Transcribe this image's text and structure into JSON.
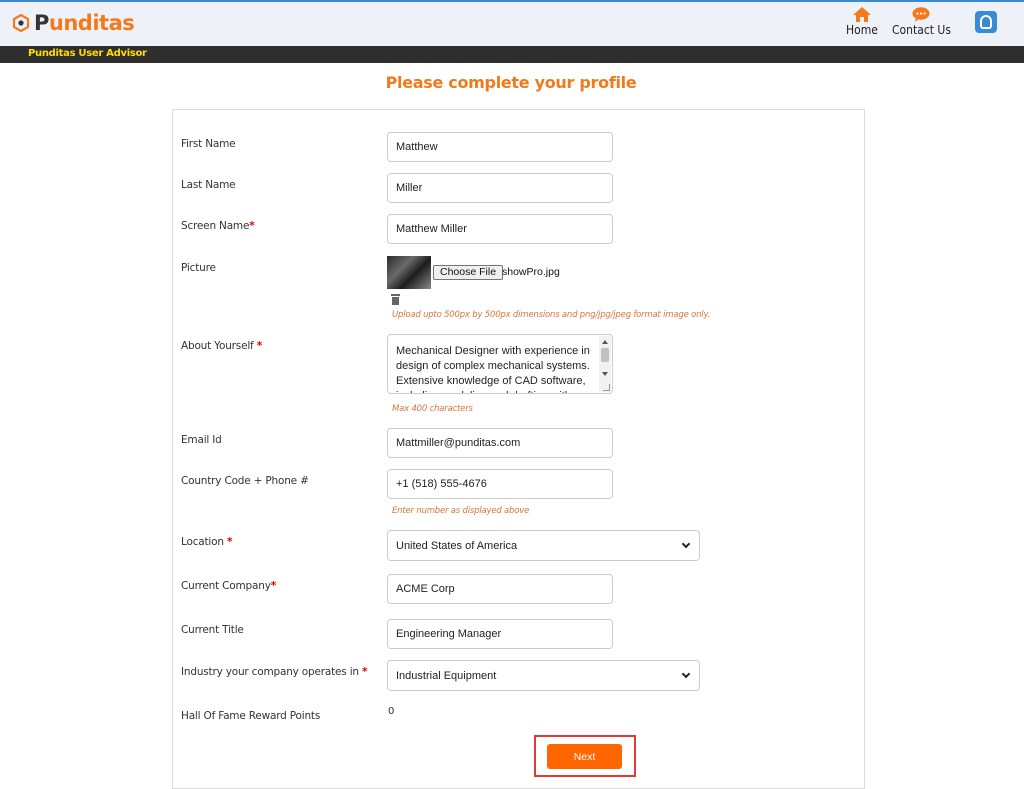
{
  "header": {
    "logo_prefix": "P",
    "logo_rest": "unditas",
    "nav_home": "Home",
    "nav_contact": "Contact Us",
    "subbar_label": "Punditas User Advisor",
    "brand_color": "#f27a1a"
  },
  "page": {
    "title": "Please complete your profile"
  },
  "form": {
    "first_name": {
      "label": "First Name",
      "value": "Matthew"
    },
    "last_name": {
      "label": "Last Name",
      "value": "Miller"
    },
    "screen_name": {
      "label": "Screen Name",
      "required": "*",
      "value": "Matthew Miller"
    },
    "picture": {
      "label": "Picture",
      "choose_label": "Choose File",
      "file_name": "showPro.jpg",
      "hint": "Upload upto 500px by 500px dimensions and png/jpg/jpeg format image only."
    },
    "about": {
      "label": "About Yourself ",
      "required": "*",
      "value": "Mechanical Designer with experience in design of complex mechanical systems. Extensive knowledge of CAD software, including modeling and drafting with PTC",
      "hint": "Max 400 characters"
    },
    "email": {
      "label": "Email Id",
      "value": "Mattmiller@punditas.com"
    },
    "phone": {
      "label": "Country Code + Phone #",
      "value": "+1 (518) 555-4676",
      "hint": "Enter number as displayed above"
    },
    "location": {
      "label": "Location ",
      "required": "*",
      "value": "United States of America"
    },
    "company": {
      "label": "Current Company",
      "required": "*",
      "value": "ACME Corp"
    },
    "title": {
      "label": "Current Title",
      "value": "Engineering Manager"
    },
    "industry": {
      "label": "Industry your company operates in ",
      "required": "*",
      "value": "Industrial Equipment"
    },
    "reward_points": {
      "label": "Hall Of Fame Reward Points",
      "value": "0"
    },
    "next_label": "Next"
  },
  "icons": [
    "logo-icon",
    "home-icon",
    "chat-icon",
    "user-icon",
    "trash-icon",
    "chevron-down-icon"
  ]
}
